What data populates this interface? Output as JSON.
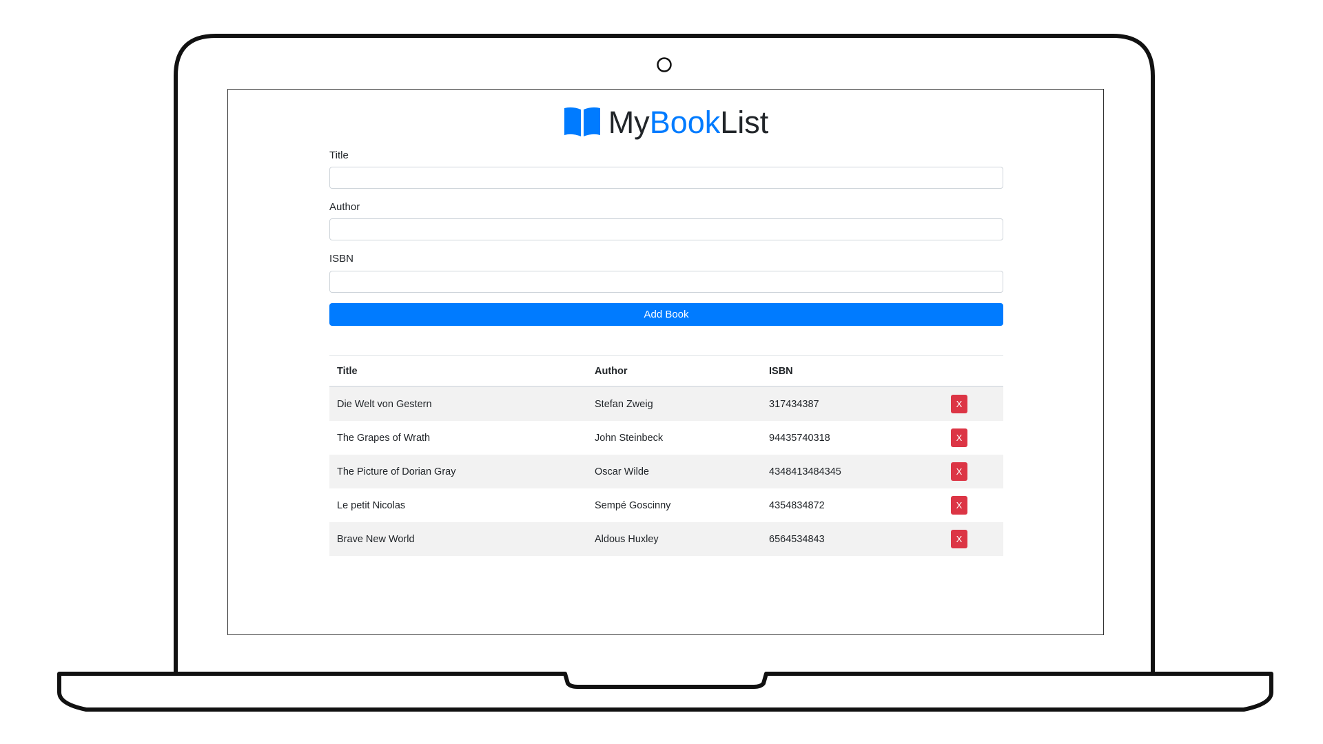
{
  "app": {
    "brand_prefix": "My",
    "brand_accent": "Book",
    "brand_suffix": "List",
    "logo_icon": "book-open-icon",
    "accent_color": "#007bff",
    "danger_color": "#dc3545"
  },
  "form": {
    "title_label": "Title",
    "title_value": "",
    "author_label": "Author",
    "author_value": "",
    "isbn_label": "ISBN",
    "isbn_value": "",
    "submit_label": "Add Book"
  },
  "table": {
    "headers": {
      "title": "Title",
      "author": "Author",
      "isbn": "ISBN"
    },
    "delete_label": "X",
    "rows": [
      {
        "title": "Die Welt von Gestern",
        "author": "Stefan Zweig",
        "isbn": "317434387"
      },
      {
        "title": "The Grapes of Wrath",
        "author": "John Steinbeck",
        "isbn": "94435740318"
      },
      {
        "title": "The Picture of Dorian Gray",
        "author": "Oscar Wilde",
        "isbn": "4348413484345"
      },
      {
        "title": "Le petit Nicolas",
        "author": "Sempé Goscinny",
        "isbn": "4354834872"
      },
      {
        "title": "Brave New World",
        "author": "Aldous Huxley",
        "isbn": "6564534843"
      }
    ]
  }
}
